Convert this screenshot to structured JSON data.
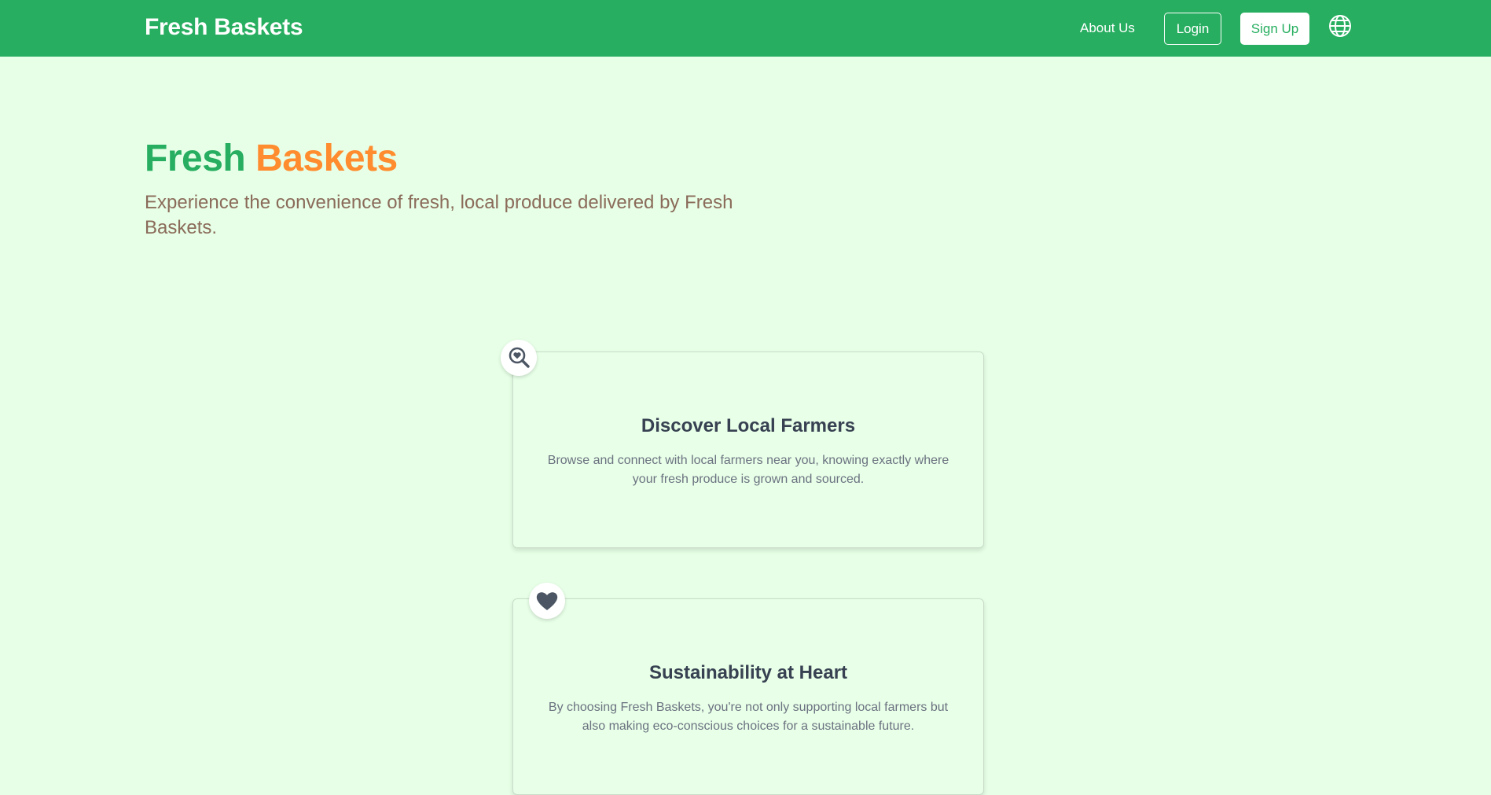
{
  "navbar": {
    "brand": "Fresh Baskets",
    "about_label": "About Us",
    "login_label": "Login",
    "signup_label": "Sign Up",
    "language_icon": "globe-icon"
  },
  "hero": {
    "title_word1": "Fresh",
    "title_word2": "Baskets",
    "subtitle": "Experience the convenience of fresh, local produce delivered by Fresh Baskets."
  },
  "features": [
    {
      "icon": "search-heart-icon",
      "title": "Discover Local Farmers",
      "text": "Browse and connect with local farmers near you, knowing exactly where your fresh produce is grown and sourced."
    },
    {
      "icon": "heart-icon",
      "title": "Sustainability at Heart",
      "text": "By choosing Fresh Baskets, you're not only supporting local farmers but also making eco-conscious choices for a sustainable future."
    }
  ],
  "colors": {
    "primary": "#27ae60",
    "accent": "#ff8c2e",
    "background": "#e6ffe6",
    "card_background": "#e8ffe8",
    "subtitle": "#8b6b5a",
    "card_title": "#374151",
    "card_text": "#6b7280"
  }
}
